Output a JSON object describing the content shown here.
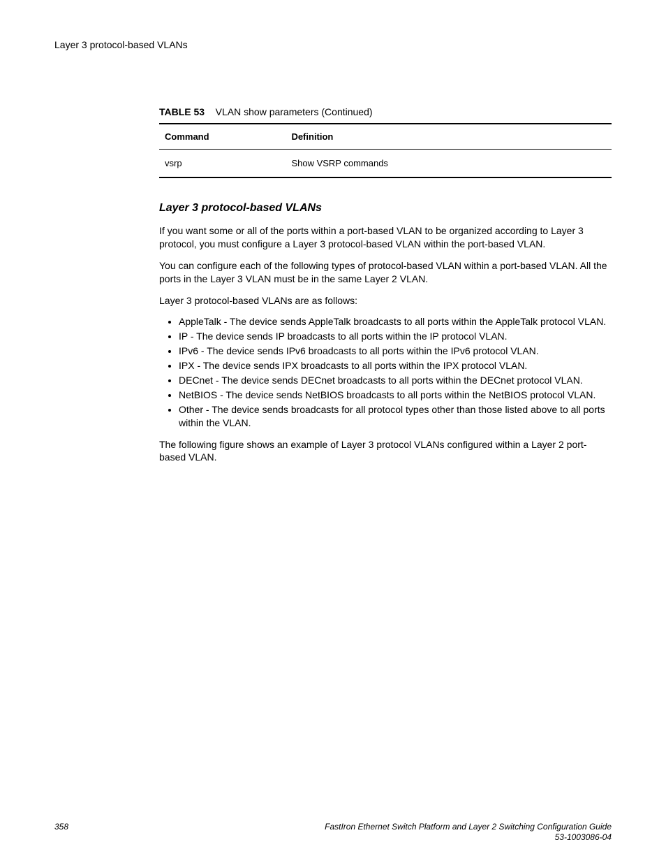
{
  "runningHead": "Layer 3 protocol-based VLANs",
  "table": {
    "label": "TABLE 53",
    "title": "VLAN show parameters (Continued)",
    "headers": {
      "command": "Command",
      "definition": "Definition"
    },
    "rows": [
      {
        "command": "vsrp",
        "definition": "Show VSRP commands"
      }
    ]
  },
  "section": {
    "heading": "Layer 3 protocol-based VLANs",
    "para1": "If you want some or all of the ports within a port-based VLAN to be organized according to Layer 3 protocol, you must configure a Layer 3 protocol-based VLAN within the port-based VLAN.",
    "para2": "You can configure each of the following types of protocol-based VLAN within a port-based VLAN. All the ports in the Layer 3 VLAN must be in the same Layer 2 VLAN.",
    "para3": "Layer 3 protocol-based VLANs are as follows:",
    "bullets": [
      "AppleTalk - The device sends AppleTalk broadcasts to all ports within the AppleTalk protocol VLAN.",
      "IP - The device sends IP broadcasts to all ports within the IP protocol VLAN.",
      "IPv6 - The device sends IPv6 broadcasts to all ports within the IPv6 protocol VLAN.",
      "IPX - The device sends IPX broadcasts to all ports within the IPX protocol VLAN.",
      "DECnet - The device sends DECnet broadcasts to all ports within the DECnet protocol VLAN.",
      "NetBIOS - The device sends NetBIOS broadcasts to all ports within the NetBIOS protocol VLAN.",
      "Other - The device sends broadcasts for all protocol types other than those listed above to all ports within the VLAN."
    ],
    "para4": "The following figure shows an example of Layer 3 protocol VLANs configured within a Layer 2 port-based VLAN."
  },
  "footer": {
    "pageNumber": "358",
    "docTitle": "FastIron Ethernet Switch Platform and Layer 2 Switching Configuration Guide",
    "docNumber": "53-1003086-04"
  }
}
